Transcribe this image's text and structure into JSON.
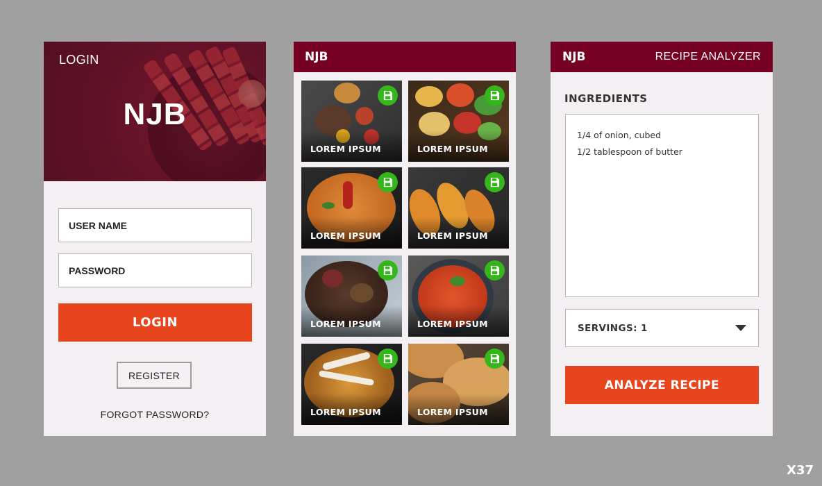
{
  "login_screen": {
    "header_label": "LOGIN",
    "logo": "NJB",
    "username_placeholder": "USER NAME",
    "password_placeholder": "PASSWORD",
    "login_button": "LOGIN",
    "register_button": "REGISTER",
    "forgot_link": "FORGOT PASSWORD?"
  },
  "gallery_screen": {
    "brand": "NJB",
    "cards": [
      {
        "label": "LOREM IPSUM",
        "icon": "save-icon"
      },
      {
        "label": "LOREM IPSUM",
        "icon": "save-icon"
      },
      {
        "label": "LOREM IPSUM",
        "icon": "save-icon"
      },
      {
        "label": "LOREM IPSUM",
        "icon": "save-icon"
      },
      {
        "label": "LOREM IPSUM",
        "icon": "save-icon"
      },
      {
        "label": "LOREM IPSUM",
        "icon": "save-icon"
      },
      {
        "label": "LOREM IPSUM",
        "icon": "save-icon"
      },
      {
        "label": "LOREM IPSUM",
        "icon": "save-icon"
      }
    ]
  },
  "analyzer_screen": {
    "brand": "NJB",
    "title": "RECIPE ANALYZER",
    "ingredients_heading": "INGREDIENTS",
    "ingredients": [
      "1/4 of onion, cubed",
      "1/2 tablespoon of butter"
    ],
    "servings": "SERVINGS: 1",
    "analyze_button": "ANALYZE RECIPE"
  },
  "corner_label": "X37",
  "colors": {
    "background": "#a0a0a0",
    "panel": "#f3eff2",
    "header": "#750024",
    "accent": "#e8441d",
    "save_green": "#35b61b"
  }
}
